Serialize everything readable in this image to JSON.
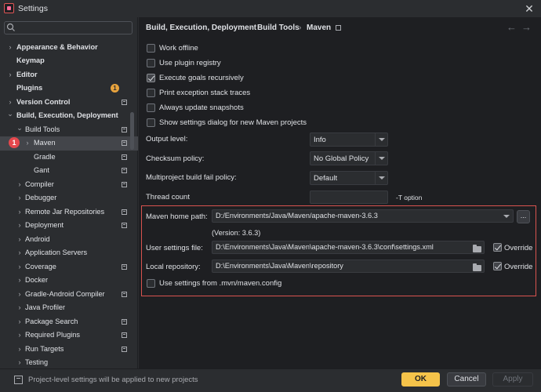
{
  "window": {
    "title": "Settings",
    "icon": "intellij-app-icon"
  },
  "search": {
    "value": "",
    "placeholder": ""
  },
  "sidebar": {
    "items": [
      {
        "label": "Appearance & Behavior",
        "arrow": "right"
      },
      {
        "label": "Keymap",
        "arrow": ""
      },
      {
        "label": "Editor",
        "arrow": "right"
      },
      {
        "label": "Plugins",
        "arrow": "",
        "badge": "1"
      },
      {
        "label": "Version Control",
        "arrow": "right"
      },
      {
        "label": "Build, Execution, Deployment",
        "arrow": "down"
      },
      {
        "label": "Build Tools",
        "arrow": "down"
      },
      {
        "label": "Maven",
        "arrow": "right",
        "badge": "1",
        "selected": true
      },
      {
        "label": "Gradle",
        "arrow": ""
      },
      {
        "label": "Gant",
        "arrow": ""
      },
      {
        "label": "Compiler",
        "arrow": "right"
      },
      {
        "label": "Debugger",
        "arrow": "right"
      },
      {
        "label": "Remote Jar Repositories",
        "arrow": "right"
      },
      {
        "label": "Deployment",
        "arrow": "right"
      },
      {
        "label": "Android",
        "arrow": "right"
      },
      {
        "label": "Application Servers",
        "arrow": "right"
      },
      {
        "label": "Coverage",
        "arrow": "right"
      },
      {
        "label": "Docker",
        "arrow": "right"
      },
      {
        "label": "Gradle-Android Compiler",
        "arrow": "right"
      },
      {
        "label": "Java Profiler",
        "arrow": "right"
      },
      {
        "label": "Package Search",
        "arrow": "right"
      },
      {
        "label": "Required Plugins",
        "arrow": "right"
      },
      {
        "label": "Run Targets",
        "arrow": "right"
      },
      {
        "label": "Testing",
        "arrow": "right"
      }
    ]
  },
  "breadcrumb": {
    "items": [
      "Build, Execution, Deployment",
      "Build Tools",
      "Maven"
    ],
    "separator": "›",
    "back": "←",
    "forward": "→"
  },
  "options": [
    {
      "label": "Work offline",
      "checked": false
    },
    {
      "label": "Use plugin registry",
      "checked": false
    },
    {
      "label": "Execute goals recursively",
      "checked": true
    },
    {
      "label": "Print exception stack traces",
      "checked": false
    },
    {
      "label": "Always update snapshots",
      "checked": false
    },
    {
      "label": "Show settings dialog for new Maven projects",
      "checked": false
    }
  ],
  "form": {
    "output_level": {
      "label": "Output level:",
      "value": "Info"
    },
    "checksum_policy": {
      "label": "Checksum policy:",
      "value": "No Global Policy"
    },
    "fail_policy": {
      "label": "Multiproject build fail policy:",
      "value": "Default"
    },
    "thread_count": {
      "label": "Thread count",
      "value": "",
      "suffix": "-T option"
    }
  },
  "maven": {
    "home_label": "Maven home path:",
    "home_value": "D:/Environments/Java/Maven/apache-maven-3.6.3",
    "browse_label": "...",
    "version": "(Version: 3.6.3)",
    "user_settings_label": "User settings file:",
    "user_settings_value": "D:\\Environments\\Java\\Maven\\apache-maven-3.6.3\\conf\\settings.xml",
    "local_repo_label": "Local repository:",
    "local_repo_value": "D:\\Environments\\Java\\Maven\\repository",
    "override_label": "Override",
    "mvn_config_label": "Use settings from .mvn/maven.config"
  },
  "footer": {
    "note": "Project-level settings will be applied to new projects",
    "ok": "OK",
    "cancel": "Cancel",
    "apply": "Apply"
  },
  "colors": {
    "accent": "#f5c34a",
    "highlight_frame": "#d9534f",
    "badge_red": "#e5484d",
    "badge_orange": "#e8a33d"
  }
}
